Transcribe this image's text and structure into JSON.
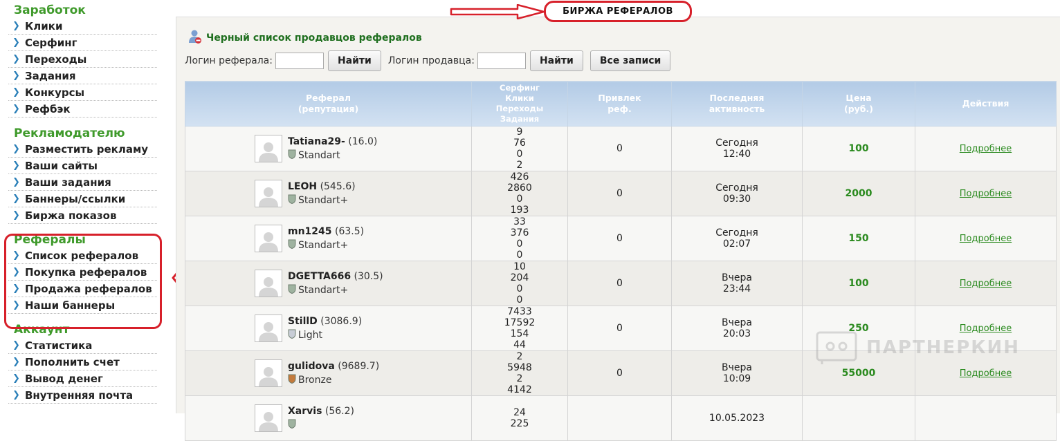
{
  "sidebar": {
    "sections": [
      {
        "title": "Заработок",
        "items": [
          "Клики",
          "Серфинг",
          "Переходы",
          "Задания",
          "Конкурсы",
          "Рефбэк"
        ]
      },
      {
        "title": "Рекламодателю",
        "items": [
          "Разместить рекламу",
          "Ваши сайты",
          "Ваши задания",
          "Баннеры/ссылки",
          "Биржа показов"
        ]
      },
      {
        "title": "Рефералы",
        "items": [
          "Список рефералов",
          "Покупка рефералов",
          "Продажа рефералов",
          "Наши баннеры"
        ]
      },
      {
        "title": "Аккаунт",
        "items": [
          "Статистика",
          "Пополнить счет",
          "Вывод денег",
          "Внутренняя почта"
        ]
      }
    ]
  },
  "header": {
    "title": "БИРЖА РЕФЕРАЛОВ"
  },
  "main": {
    "subtitle": "Черный список продавцов рефералов",
    "search": {
      "referral_label": "Логин реферала:",
      "seller_label": "Логин продавца:",
      "find_label": "Найти",
      "all_label": "Все записи"
    }
  },
  "table": {
    "headers": {
      "referral": [
        "Реферал",
        "(репутация)"
      ],
      "stats": [
        "Серфинг",
        "Клики",
        "Переходы",
        "Задания"
      ],
      "invited": [
        "Привлек",
        "реф."
      ],
      "last_activity": [
        "Последняя",
        "активность"
      ],
      "price": [
        "Цена",
        "(руб.)"
      ],
      "actions": [
        "Действия"
      ]
    },
    "rows": [
      {
        "name": "Tatiana29-",
        "rep": "(16.0)",
        "status": "Standart",
        "status_color": "#9fb3a0",
        "stats": [
          "9",
          "76",
          "0",
          "2"
        ],
        "invited": "0",
        "day": "Сегодня",
        "time": "12:40",
        "price": "100",
        "action": "Подробнее"
      },
      {
        "name": "LEOH",
        "rep": "(545.6)",
        "status": "Standart+",
        "status_color": "#9fb3a0",
        "stats": [
          "426",
          "2860",
          "0",
          "193"
        ],
        "invited": "0",
        "day": "Сегодня",
        "time": "09:30",
        "price": "2000",
        "action": "Подробнее"
      },
      {
        "name": "mn1245",
        "rep": "(63.5)",
        "status": "Standart+",
        "status_color": "#9fb3a0",
        "stats": [
          "33",
          "376",
          "0",
          "0"
        ],
        "invited": "0",
        "day": "Сегодня",
        "time": "02:07",
        "price": "150",
        "action": "Подробнее"
      },
      {
        "name": "DGETTA666",
        "rep": "(30.5)",
        "status": "Standart+",
        "status_color": "#9fb3a0",
        "stats": [
          "10",
          "204",
          "0",
          "0"
        ],
        "invited": "0",
        "day": "Вчера",
        "time": "23:44",
        "price": "100",
        "action": "Подробнее"
      },
      {
        "name": "StillD",
        "rep": "(3086.9)",
        "status": "Light",
        "status_color": "#c8cdd6",
        "stats": [
          "7433",
          "17592",
          "154",
          "44"
        ],
        "invited": "0",
        "day": "Вчера",
        "time": "20:03",
        "price": "250",
        "action": "Подробнее"
      },
      {
        "name": "gulidova",
        "rep": "(9689.7)",
        "status": "Bronze",
        "status_color": "#c47a3b",
        "stats": [
          "2",
          "5948",
          "2",
          "4142"
        ],
        "invited": "0",
        "day": "Вчера",
        "time": "10:09",
        "price": "55000",
        "action": "Подробнее"
      },
      {
        "name": "Xarvis",
        "rep": "(56.2)",
        "status": "",
        "status_color": "#9fb3a0",
        "stats": [
          "24",
          "225",
          "",
          ""
        ],
        "invited": "",
        "day": "10.05.2023",
        "time": "",
        "price": "",
        "action": ""
      }
    ]
  },
  "watermark": {
    "text": "ПАРТНЕРКИН"
  },
  "colors": {
    "accent_green": "#3f9a2b",
    "highlight_red": "#d7202a",
    "header_blue": "#b3cbe6"
  }
}
